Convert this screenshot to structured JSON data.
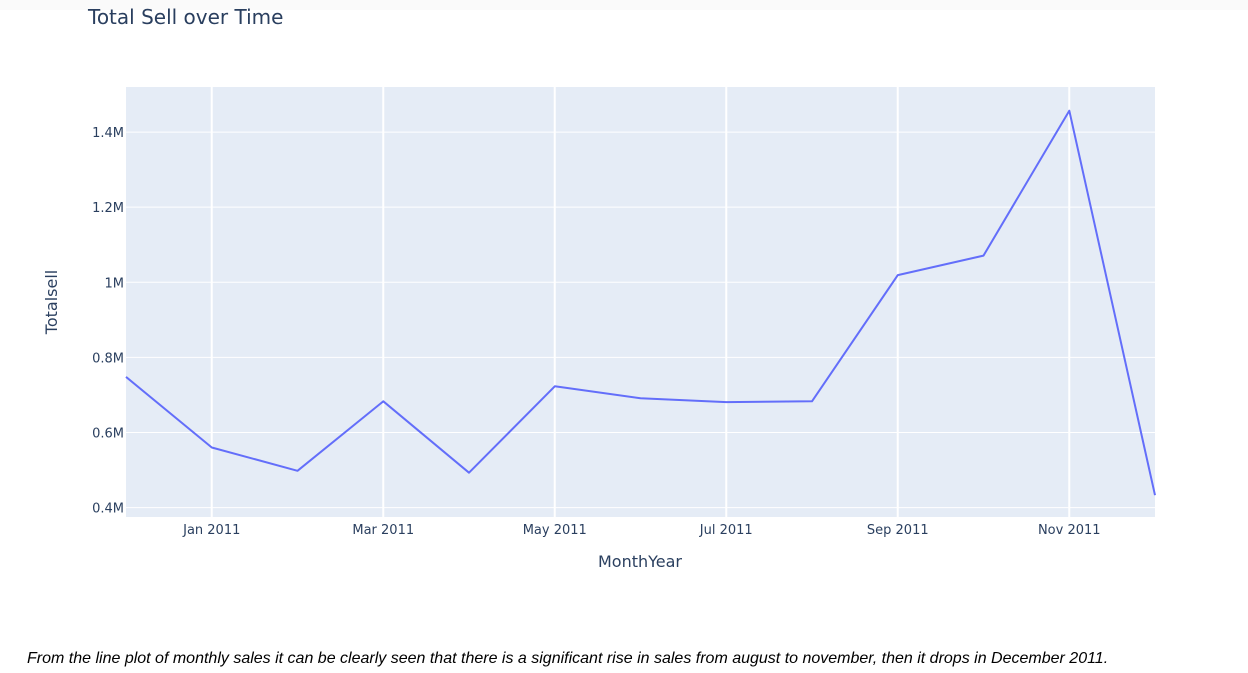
{
  "chart_data": {
    "type": "line",
    "title": "Total Sell over Time",
    "xlabel": "MonthYear",
    "ylabel": "Totalsell",
    "x": [
      "2010-12",
      "2011-01",
      "2011-02",
      "2011-03",
      "2011-04",
      "2011-05",
      "2011-06",
      "2011-07",
      "2011-08",
      "2011-09",
      "2011-10",
      "2011-11",
      "2011-12"
    ],
    "series": [
      {
        "values": [
          748000,
          560000,
          498000,
          683000,
          493000,
          723000,
          691000,
          681000,
          683000,
          1019000,
          1071000,
          1457000,
          433000
        ]
      }
    ],
    "x_ticks": [
      "Jan 2011",
      "Mar 2011",
      "May 2011",
      "Jul 2011",
      "Sep 2011",
      "Nov 2011"
    ],
    "y_ticks": [
      {
        "value": 400000,
        "label": "0.4M"
      },
      {
        "value": 600000,
        "label": "0.6M"
      },
      {
        "value": 800000,
        "label": "0.8M"
      },
      {
        "value": 1000000,
        "label": "1M"
      },
      {
        "value": 1200000,
        "label": "1.2M"
      },
      {
        "value": 1400000,
        "label": "1.4M"
      }
    ],
    "ylim": [
      375000,
      1520000
    ],
    "grid": true,
    "line_color": "#636efa",
    "plot_background": "#e5ecf6"
  },
  "caption": "From the line plot of monthly sales it can be clearly seen that there is a significant rise in sales from august to november, then it drops in December 2011."
}
